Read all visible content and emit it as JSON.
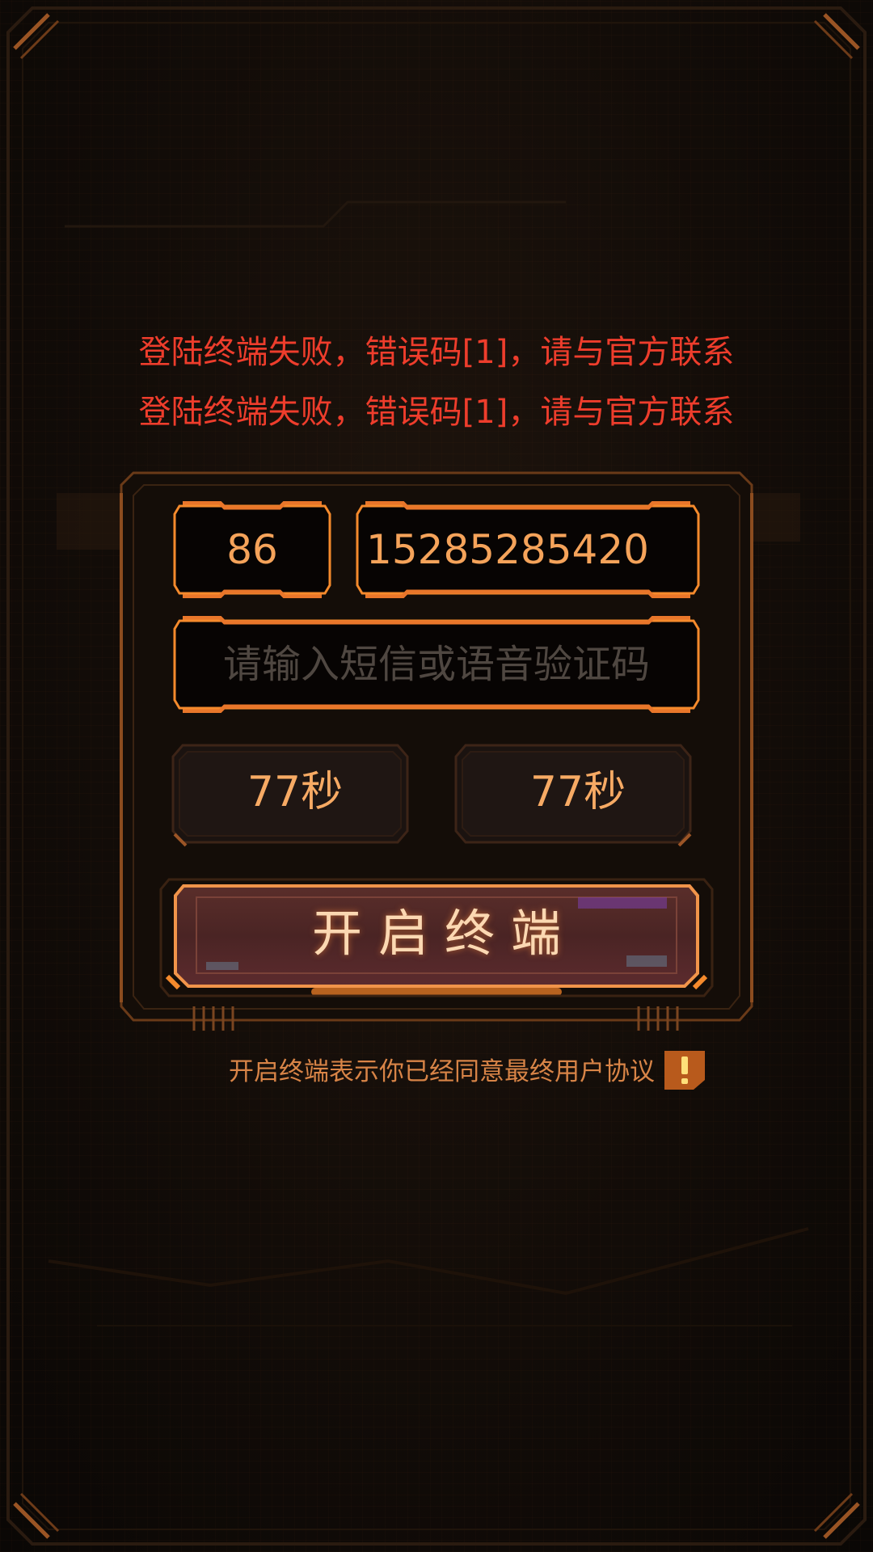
{
  "errors": [
    "登陆终端失败，错误码[1]，请与官方联系",
    "登陆终端失败，错误码[1]，请与官方联系"
  ],
  "login": {
    "country_code": "86",
    "phone": "15285285420",
    "code_placeholder": "请输入短信或语音验证码",
    "sms_timer": "77秒",
    "voice_timer": "77秒",
    "submit_label": "开启终端"
  },
  "footer": {
    "agreement": "开启终端表示你已经同意最终用户协议",
    "info_icon": "exclamation-icon"
  },
  "colors": {
    "accent": "#f58a2c",
    "error": "#ee3d2c",
    "text": "#f5a35a",
    "placeholder": "#4f4741"
  }
}
